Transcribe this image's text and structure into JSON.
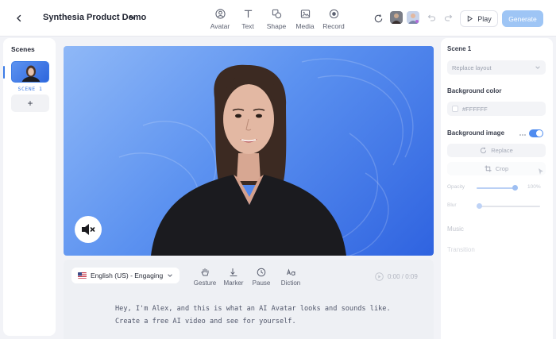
{
  "header": {
    "back_icon": "chevron-left-icon",
    "title": "Synthesia Product Demo",
    "tools": [
      {
        "label": "Avatar",
        "icon": "avatar-icon"
      },
      {
        "label": "Text",
        "icon": "text-icon"
      },
      {
        "label": "Shape",
        "icon": "shape-icon"
      },
      {
        "label": "Media",
        "icon": "media-icon"
      },
      {
        "label": "Record",
        "icon": "record-icon"
      }
    ],
    "play_label": "Play",
    "generate_label": "Generate"
  },
  "scenes": {
    "title": "Scenes",
    "items": [
      {
        "label": "SCENE 1"
      }
    ],
    "add_label": "+"
  },
  "script": {
    "language": "English (US) - Engaging",
    "tools": [
      {
        "label": "Gesture",
        "icon": "gesture-icon"
      },
      {
        "label": "Marker",
        "icon": "marker-icon"
      },
      {
        "label": "Pause",
        "icon": "pause-clock-icon"
      },
      {
        "label": "Diction",
        "icon": "diction-icon"
      }
    ],
    "timer": "0:00 / 0:09",
    "lines": [
      "Hey, I'm Alex, and this is what an AI Avatar looks and sounds like.",
      "Create a free AI video and see for yourself."
    ]
  },
  "panel": {
    "scene_title": "Scene 1",
    "layout_value": "Replace layout",
    "bg_color_heading": "Background color",
    "bg_color_value": "#FFFFFF",
    "bg_image_heading": "Background image",
    "bg_image_enabled": true,
    "replace_label": "Replace",
    "crop_label": "Crop",
    "opacity_label": "Opacity",
    "opacity_value": "100%",
    "blur_label": "Blur",
    "music_heading": "Music",
    "transition_heading": "Transition"
  },
  "colors": {
    "accent": "#3c7be6",
    "generate_bg": "#9ec5f5",
    "canvas_start": "#8fb8f7",
    "canvas_end": "#2f63e0"
  }
}
